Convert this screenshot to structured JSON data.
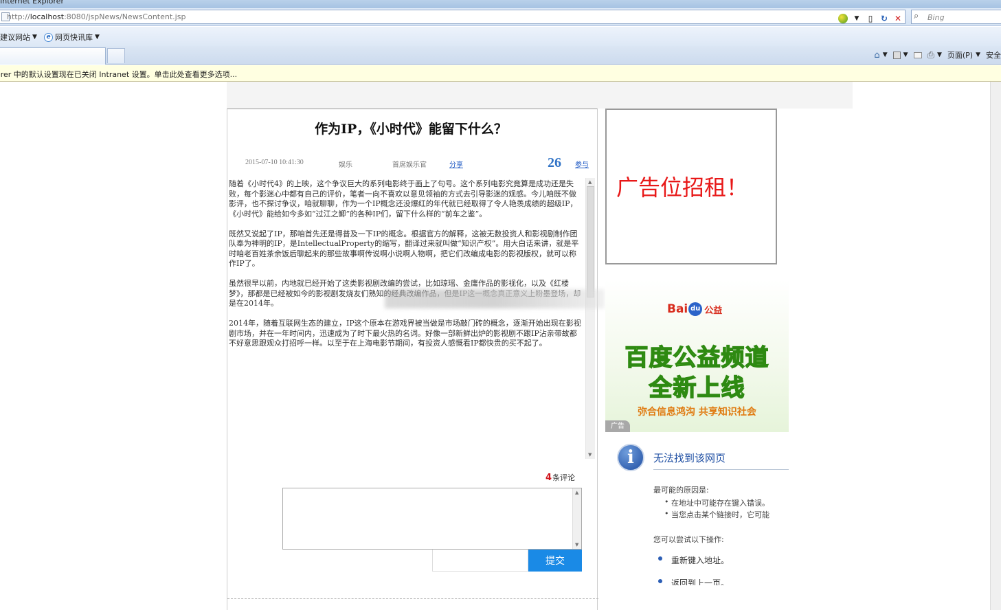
{
  "browser": {
    "title": "Internet Explorer",
    "url_prefix": "http://",
    "url_host": "localhost",
    "url_rest": ":8080/jspNews/NewsContent.jsp",
    "search_placeholder": "Bing",
    "favorites": [
      {
        "label": "建议网站"
      },
      {
        "label": "网页快讯库"
      }
    ],
    "commands": {
      "page_label": "页面(P)",
      "safety_label": "安全"
    },
    "infobar_text": "orer 中的默认设置现在已关闭 Intranet 设置。单击此处查看更多选项..."
  },
  "article": {
    "title": "作为IP，《小时代》能留下什么？",
    "date": "2015-07-10 10:41:30",
    "category": "娱乐",
    "author": "首席娱乐官",
    "share_label": "分享",
    "hits": "26",
    "join_label": "参与",
    "paragraphs": [
      "随着《小时代4》的上映，这个争议巨大的系列电影终于画上了句号。这个系列电影究竟算是成功还是失败，每个影迷心中都有自己的评价，笔者一向不喜欢以意见领袖的方式去引导影迷的观感。今儿咱既不做影评，也不探讨争议，咱就聊聊，作为一个IP概念还没爆红的年代就已经取得了令人艳羡成绩的超级IP，《小时代》能给如今多如“过江之鲫”的各种IP们，留下什么样的“前车之鉴”。",
      "既然又说起了IP，那咱首先还是得普及一下IP的概念。根据官方的解释，这被无数投资人和影视剧制作团队奉为神明的IP，是IntellectualProperty的缩写，翻译过来就叫做“知识产权”。用大白话来讲，就是平时咱老百姓茶余饭后聊起来的那些故事啊传说啊小说啊人物啊，把它们改编成电影的影视版权，就可以称作IP了。",
      "虽然很早以前，内地就已经开始了这类影视剧改编的尝试，比如琼瑶、金庸作品的影视化，以及《红楼梦》，那都是已经被如今的影视剧发烧友们熟知的经典改编作品，但是IP这一概念真正意义上粉墨登场，却是在2014年。",
      "2014年，随着互联网生态的建立，IP这个原本在游戏界被当做是市场敲门砖的概念，逐渐开始出现在影视剧市场，并在一年时间内，迅速成为了时下最火热的名词。好像一部新鲜出炉的影视剧不跟IP沾亲带故都不好意思跟观众打招呼一样。以至于在上海电影节期间，有投资人感慨看IP都快贵的买不起了。"
    ]
  },
  "comments": {
    "count": "4",
    "count_suffix": "条评论",
    "submit_label": "提交"
  },
  "sidebar": {
    "ad_text": "广告位招租！",
    "baidu": {
      "logo_a": "Bai",
      "logo_b": "du",
      "logo_c": "公益",
      "headline_1": "百度公益频道",
      "headline_2": "全新上线",
      "slogan": "弥合信息鸿沟  共享知识社会",
      "ad_tag": "广告"
    },
    "error": {
      "title": "无法找到该网页",
      "causes_heading": "最可能的原因是:",
      "causes": [
        "在地址中可能存在键入错误。",
        "当您点击某个链接时，它可能"
      ],
      "actions_heading": "您可以尝试以下操作:",
      "actions": [
        "重新键入地址。",
        "返回到上一页。"
      ]
    }
  }
}
